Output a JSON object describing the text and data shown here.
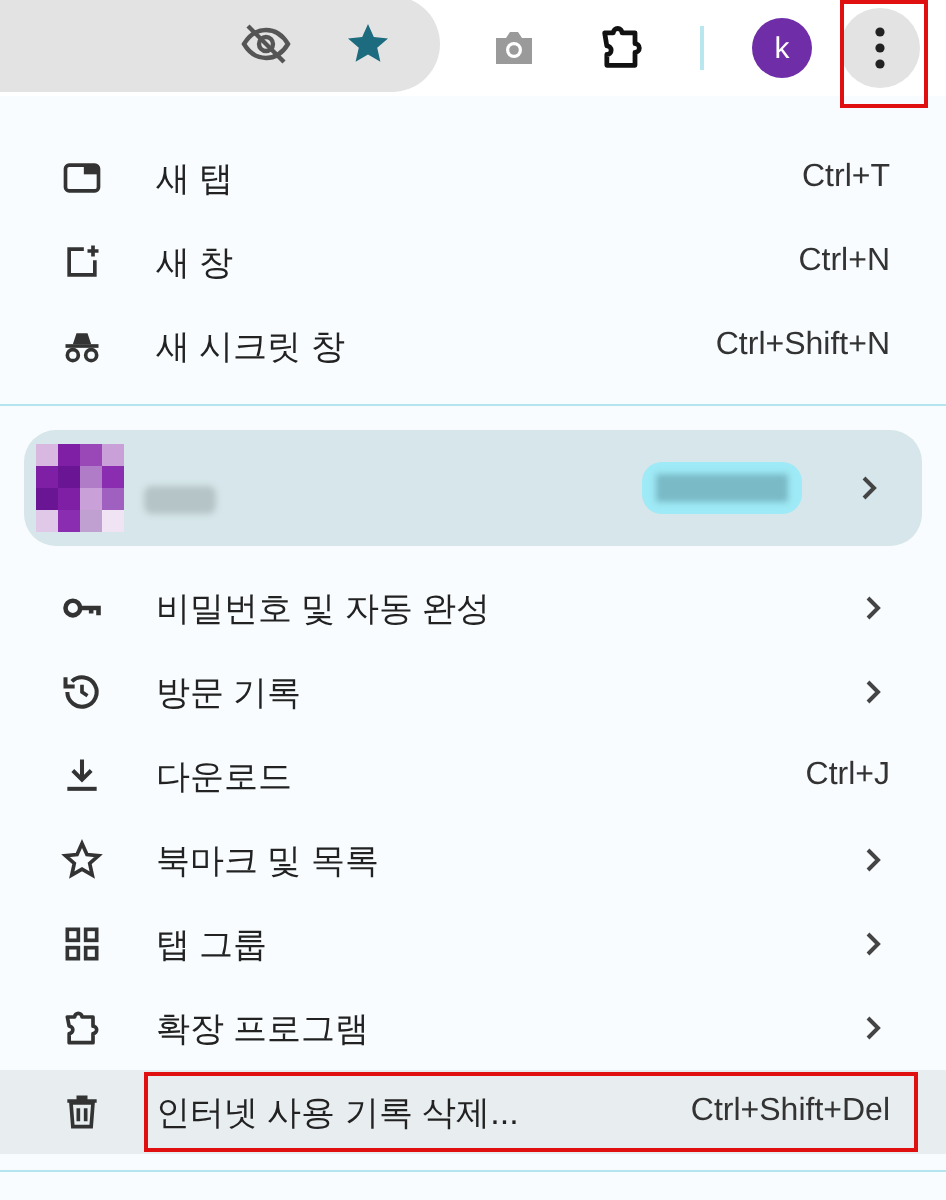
{
  "toolbar": {
    "avatar_letter": "k",
    "menu_button_annotated": true
  },
  "menu": {
    "top_items": [
      {
        "label": "새 탭",
        "kind": "shortcut",
        "shortcut": "Ctrl+T",
        "highlighted": false,
        "annotated": false
      },
      {
        "label": "새 창",
        "kind": "shortcut",
        "shortcut": "Ctrl+N",
        "highlighted": false,
        "annotated": false
      },
      {
        "label": "새 시크릿 창",
        "kind": "shortcut",
        "shortcut": "Ctrl+Shift+N",
        "highlighted": false,
        "annotated": false
      }
    ],
    "profile": {
      "redacted": true
    },
    "items": [
      {
        "label": "비밀번호 및 자동 완성",
        "kind": "submenu",
        "highlighted": false,
        "annotated": false
      },
      {
        "label": "방문 기록",
        "kind": "submenu",
        "highlighted": false,
        "annotated": false
      },
      {
        "label": "다운로드",
        "kind": "shortcut",
        "shortcut": "Ctrl+J",
        "highlighted": false,
        "annotated": false
      },
      {
        "label": "북마크 및 목록",
        "kind": "submenu",
        "highlighted": false,
        "annotated": false
      },
      {
        "label": "탭 그룹",
        "kind": "submenu",
        "highlighted": false,
        "annotated": false
      },
      {
        "label": "확장 프로그램",
        "kind": "submenu",
        "highlighted": false,
        "annotated": false
      },
      {
        "label": "인터넷 사용 기록 삭제...",
        "kind": "shortcut",
        "shortcut": "Ctrl+Shift+Del",
        "highlighted": true,
        "annotated": true
      }
    ]
  }
}
